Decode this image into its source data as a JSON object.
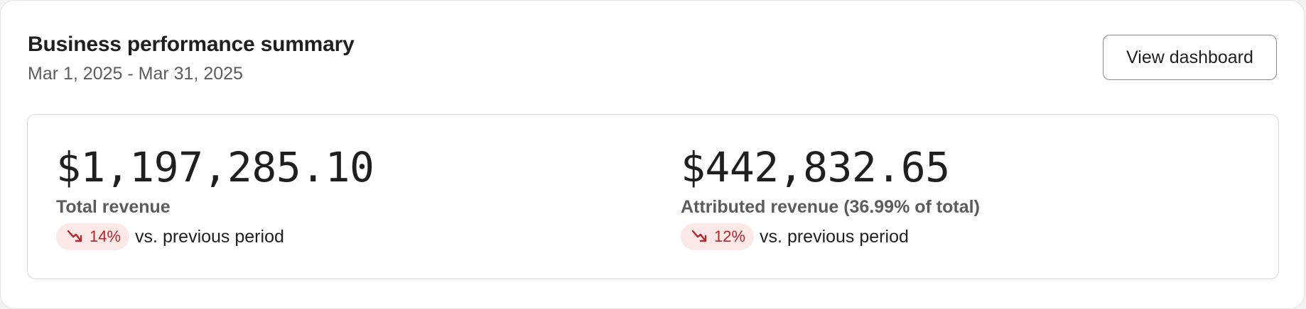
{
  "header": {
    "title": "Business performance summary",
    "date_range": "Mar 1, 2025 - Mar 31, 2025",
    "view_button_label": "View dashboard"
  },
  "metrics": [
    {
      "value": "$1,197,285.10",
      "label": "Total revenue",
      "change": "14%",
      "change_direction": "down",
      "comparison": "vs. previous period"
    },
    {
      "value": "$442,832.65",
      "label": "Attributed revenue (36.99% of total)",
      "change": "12%",
      "change_direction": "down",
      "comparison": "vs. previous period"
    }
  ],
  "icons": {
    "trend": "trend-down-icon"
  },
  "colors": {
    "negative_badge_bg": "#fde8e8",
    "negative_text": "#b3262b"
  }
}
